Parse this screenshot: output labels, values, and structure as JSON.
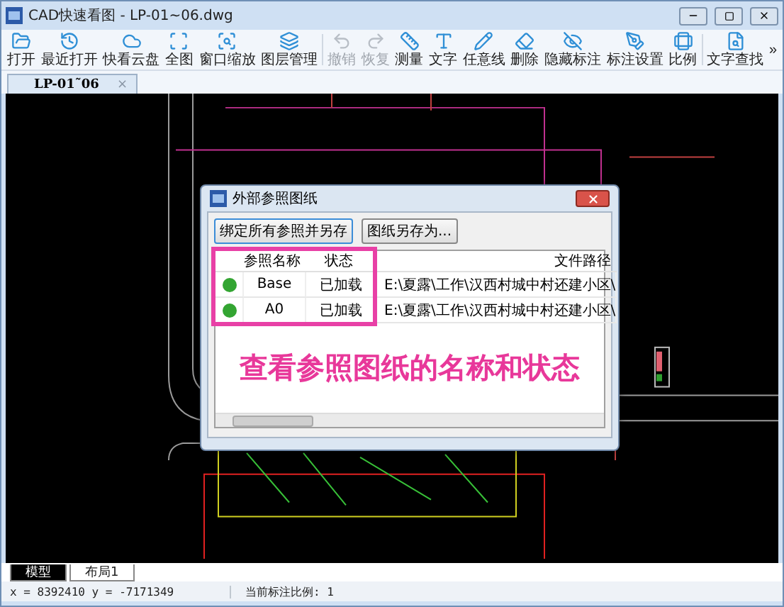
{
  "window": {
    "title": "CAD快速看图 - LP-01~06.dwg"
  },
  "toolbar_groups": [
    [
      {
        "label": "打开",
        "disabled": false
      },
      {
        "label": "最近打开",
        "disabled": false
      },
      {
        "label": "快看云盘",
        "disabled": false
      },
      {
        "label": "全图",
        "disabled": false
      },
      {
        "label": "窗口缩放",
        "disabled": false
      },
      {
        "label": "图层管理",
        "disabled": false
      }
    ],
    [
      {
        "label": "撤销",
        "disabled": true
      },
      {
        "label": "恢复",
        "disabled": true
      },
      {
        "label": "测量",
        "disabled": false
      },
      {
        "label": "文字",
        "disabled": false
      },
      {
        "label": "任意线",
        "disabled": false
      },
      {
        "label": "删除",
        "disabled": false
      },
      {
        "label": "隐藏标注",
        "disabled": false
      },
      {
        "label": "标注设置",
        "disabled": false
      },
      {
        "label": "比例",
        "disabled": false
      }
    ],
    [
      {
        "label": "文字查找",
        "disabled": false
      }
    ]
  ],
  "toolbar_more": "»",
  "doc_tabs": [
    {
      "label": "LP-01˜06",
      "close": "×",
      "selected": true
    }
  ],
  "dialog": {
    "title": "外部参照图纸",
    "buttons": [
      "绑定所有参照并另存",
      "图纸另存为..."
    ],
    "columns": [
      "参照名称",
      "状态",
      "文件路径"
    ],
    "rows": [
      {
        "name": "Base",
        "status": "已加载",
        "path": "E:\\夏露\\工作\\汉西村城中村还建小区\\",
        "color": "#33a532"
      },
      {
        "name": "A0",
        "status": "已加载",
        "path": "E:\\夏露\\工作\\汉西村城中村还建小区\\",
        "color": "#33a532"
      }
    ],
    "annotation": "查看参照图纸的名称和状态"
  },
  "layout_tabs": [
    {
      "label": "模型",
      "selected": true
    },
    {
      "label": "布局1",
      "selected": false
    }
  ],
  "status_bar": {
    "coordinates": "x = 8392410 y = -7171349",
    "scale": "当前标注比例: 1"
  }
}
